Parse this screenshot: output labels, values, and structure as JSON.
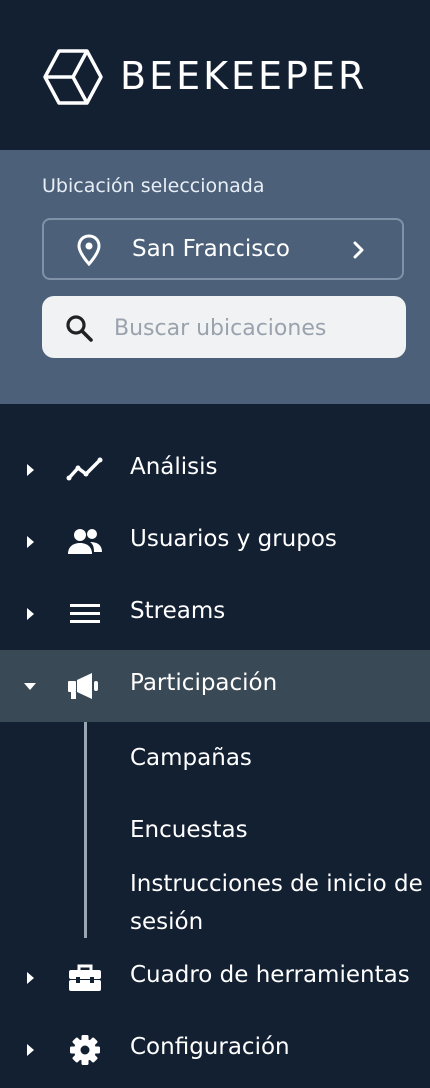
{
  "brand": {
    "name": "BEEKEEPER"
  },
  "location": {
    "label": "Ubicación seleccionada",
    "selected": "San Francisco",
    "search_placeholder": "Buscar ubicaciones"
  },
  "nav": {
    "items": [
      {
        "label": "Análisis",
        "icon": "line-chart-icon",
        "expanded": false
      },
      {
        "label": "Usuarios y grupos",
        "icon": "users-icon",
        "expanded": false
      },
      {
        "label": "Streams",
        "icon": "menu-lines-icon",
        "expanded": false
      },
      {
        "label": "Participación",
        "icon": "megaphone-icon",
        "expanded": true,
        "children": [
          "Campañas",
          "Encuestas",
          "Instrucciones de inicio de sesión"
        ]
      },
      {
        "label": "Cuadro de herramientas",
        "icon": "toolbox-icon",
        "expanded": false
      },
      {
        "label": "Configuración",
        "icon": "gear-icon",
        "expanded": false
      }
    ]
  },
  "colors": {
    "background": "#132032",
    "location_panel": "#4c6179",
    "active_row": "#3a4956",
    "search_bg": "#f0f2f4"
  }
}
